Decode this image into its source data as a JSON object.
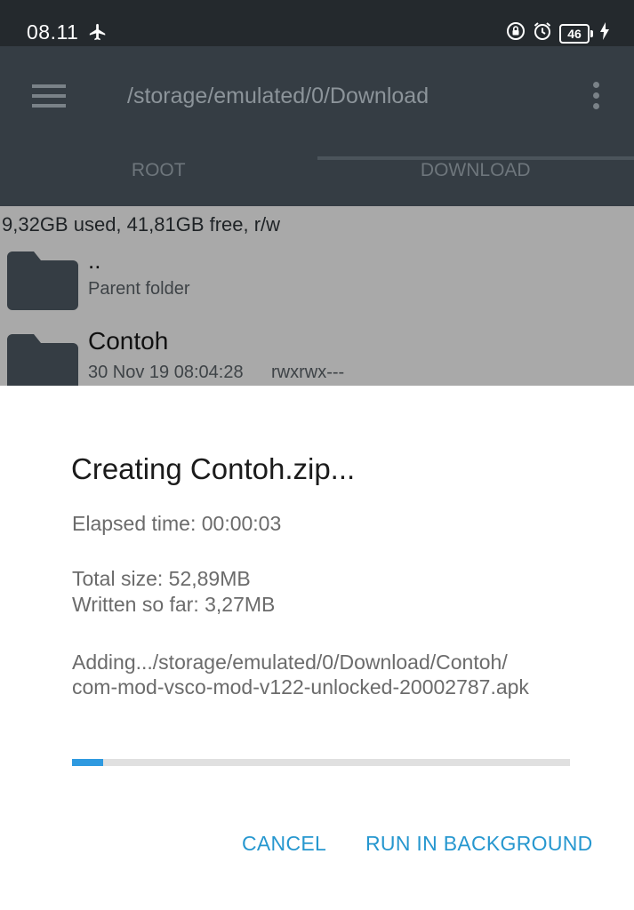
{
  "status_bar": {
    "time": "08.11",
    "airplane_icon": "airplane-icon",
    "rotation_lock_icon": "rotation-lock-icon",
    "alarm_icon": "alarm-icon",
    "battery_level": "46",
    "charging_icon": "charging-icon"
  },
  "app_bar": {
    "menu_icon": "hamburger-menu-icon",
    "path": "/storage/emulated/0/Download",
    "overflow_icon": "more-vert-icon",
    "tabs": [
      {
        "label": "ROOT"
      },
      {
        "label": "DOWNLOAD"
      }
    ]
  },
  "file_list": {
    "storage_info": "9,32GB used, 41,81GB free, r/w",
    "items": [
      {
        "name": "..",
        "subtitle": "Parent folder",
        "icon": "folder-icon"
      },
      {
        "name": "Contoh",
        "date": "30 Nov 19 08:04:28",
        "permissions": "rwxrwx---",
        "icon": "folder-icon"
      }
    ]
  },
  "dialog": {
    "title": "Creating Contoh.zip...",
    "elapsed": "Elapsed time: 00:00:03",
    "total_size": "Total size: 52,89MB",
    "written": "Written so far: 3,27MB",
    "adding_line1": "Adding.../storage/emulated/0/Download/Contoh/",
    "adding_line2": "com-mod-vsco-mod-v122-unlocked-20002787.apk",
    "progress_fraction": 0.062,
    "progress_color": "#2f9ae0",
    "cancel_label": "CANCEL",
    "background_label": "RUN IN BACKGROUND",
    "accent_color": "#2697cf"
  }
}
